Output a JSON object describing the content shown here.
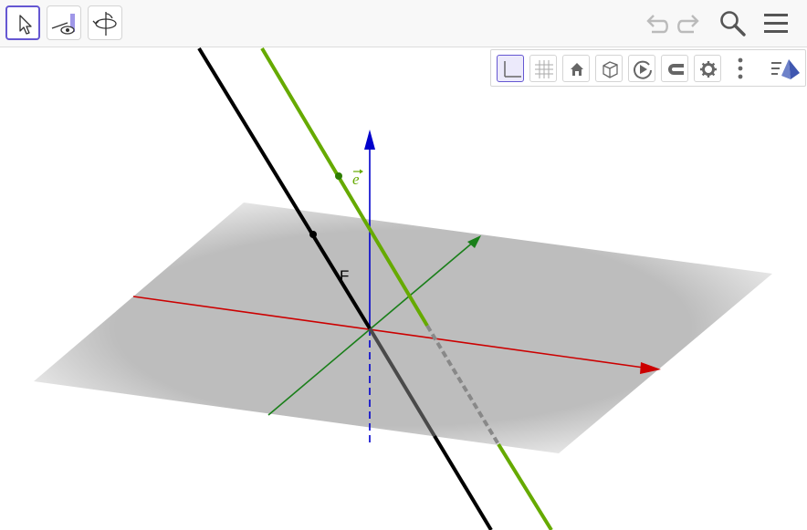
{
  "app": {
    "view": "3D Graphics"
  },
  "toolbar": {
    "tools": [
      {
        "name": "move-tool",
        "selected": true
      },
      {
        "name": "show-hide-tool",
        "selected": false
      },
      {
        "name": "rotate-view-tool",
        "selected": false
      }
    ],
    "icons": [
      "undo-icon",
      "redo-icon",
      "search-icon",
      "menu-icon"
    ]
  },
  "style_bar": {
    "buttons": [
      "axes-toggle",
      "grid-toggle",
      "standard-view",
      "view-cube",
      "rotate-view",
      "point-capturing",
      "settings",
      "more-options",
      "view-projection"
    ]
  },
  "scene": {
    "labels": {
      "point_F": "F",
      "vector_e": "e"
    },
    "colors": {
      "x_axis": "#cc0000",
      "y_axis": "#1a7f1a",
      "z_axis": "#0000cc",
      "line_black": "#000000",
      "line_green": "#66aa00",
      "plane": "#bdbdbd"
    }
  }
}
